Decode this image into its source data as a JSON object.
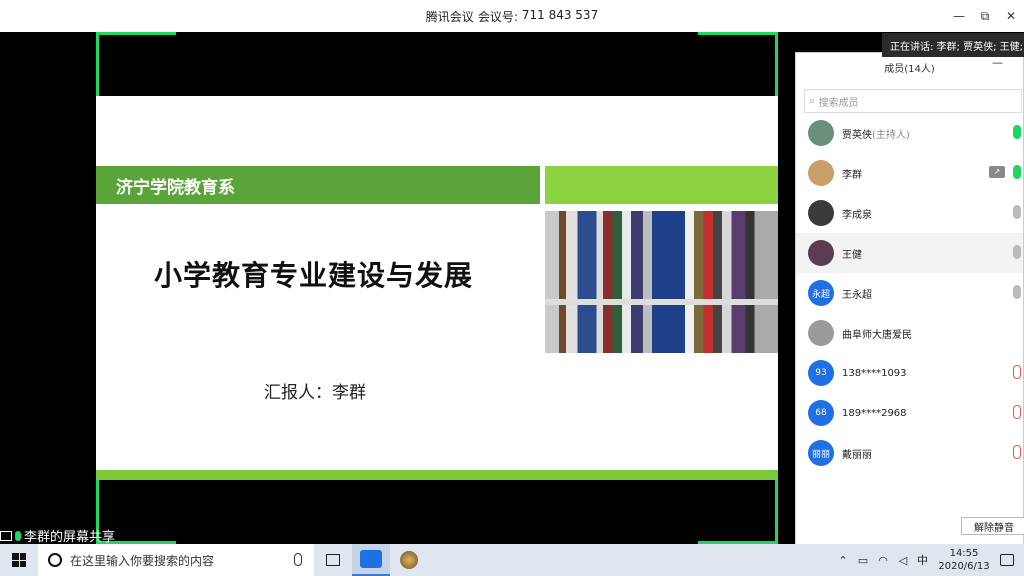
{
  "window": {
    "app_name": "腾讯会议",
    "meeting_label": "会议号:",
    "meeting_id": "711 843 537",
    "controls": {
      "minimize": "—",
      "restore": "⧉",
      "close": "✕"
    }
  },
  "slide": {
    "department": "济宁学院教育系",
    "title": "小学教育专业建设与发展",
    "reporter": "汇报人：李群"
  },
  "screen_share_label": "李群的屏幕共享",
  "speaking": "正在讲话: 李群; 贾英侠; 王健;",
  "members_panel": {
    "title": "成员(14人)",
    "minimize": "—",
    "search_placeholder": "搜索成员",
    "members": [
      {
        "name": "贾英侠",
        "tag": "(主持人)",
        "avatar_text": "",
        "avatar_color": "#6a8f7a",
        "mic": "on"
      },
      {
        "name": "李群",
        "tag": "",
        "avatar_text": "",
        "avatar_color": "#c9a06a",
        "mic": "on",
        "sharing": true
      },
      {
        "name": "李成泉",
        "tag": "",
        "avatar_text": "",
        "avatar_color": "#3a3a3a",
        "mic": "idle"
      },
      {
        "name": "王健",
        "tag": "",
        "avatar_text": "",
        "avatar_color": "#5a3d52",
        "mic": "idle"
      },
      {
        "name": "王永超",
        "tag": "",
        "avatar_text": "永超",
        "avatar_color": "#1f6fe5",
        "mic": "idle"
      },
      {
        "name": "曲阜师大唐爱民",
        "tag": "",
        "avatar_text": "",
        "avatar_color": "#9a9a9a",
        "mic": "none"
      },
      {
        "name": "138****1093",
        "tag": "",
        "avatar_text": "93",
        "avatar_color": "#1f6fe5",
        "mic": "off"
      },
      {
        "name": "189****2968",
        "tag": "",
        "avatar_text": "68",
        "avatar_color": "#1f6fe5",
        "mic": "off"
      },
      {
        "name": "戴丽丽",
        "tag": "",
        "avatar_text": "丽丽",
        "avatar_color": "#1f6fe5",
        "mic": "off"
      }
    ],
    "unmute_all": "解除静音"
  },
  "taskbar": {
    "search_placeholder": "在这里输入你要搜索的内容",
    "ime": "中",
    "time": "14:55",
    "date": "2020/6/13"
  }
}
